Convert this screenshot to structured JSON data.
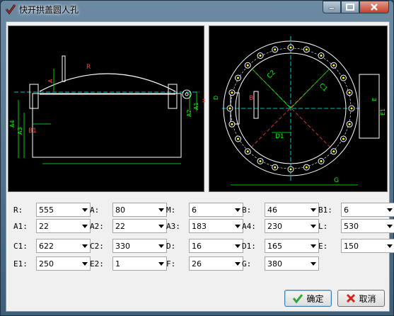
{
  "window": {
    "title": "快开拱盖圆人孔",
    "icons": {
      "app": "check-mark-icon",
      "minimize": "minimize-icon",
      "maximize": "maximize-icon",
      "close": "close-icon"
    },
    "colors": {
      "canvas_bg": "#000000",
      "drawing_white": "#ffffff",
      "dimension_green": "#00ff00",
      "centerline_cyan": "#00ffff",
      "label_red": "#ff4040",
      "bolt_yellow": "#ffff00"
    }
  },
  "drawings": {
    "side_view": {
      "labels": [
        "R",
        "A4",
        "A3",
        "A",
        "B1",
        "A2",
        "A1",
        "H"
      ]
    },
    "top_view": {
      "labels": [
        "C2",
        "C1",
        "D1",
        "D",
        "B",
        "G",
        "E1",
        "E"
      ]
    }
  },
  "params": {
    "R": {
      "label": "R:",
      "value": "555"
    },
    "A": {
      "label": "A:",
      "value": "80"
    },
    "M": {
      "label": "M:",
      "value": "6"
    },
    "B": {
      "label": "B:",
      "value": "46"
    },
    "B1": {
      "label": "B1:",
      "value": "6"
    },
    "A1": {
      "label": "A1:",
      "value": "22"
    },
    "A2": {
      "label": "A2:",
      "value": "22"
    },
    "A3": {
      "label": "A3:",
      "value": "183"
    },
    "A4": {
      "label": "A4:",
      "value": "230"
    },
    "L": {
      "label": "L:",
      "value": "530"
    },
    "C1": {
      "label": "C1:",
      "value": "622"
    },
    "C2": {
      "label": "C2:",
      "value": "330"
    },
    "D": {
      "label": "D:",
      "value": "16"
    },
    "D1": {
      "label": "D1:",
      "value": "165"
    },
    "E": {
      "label": "E:",
      "value": "150"
    },
    "E1": {
      "label": "E1:",
      "value": "250"
    },
    "E2": {
      "label": "E2:",
      "value": "1"
    },
    "F": {
      "label": "F:",
      "value": "26"
    },
    "G": {
      "label": "G:",
      "value": "380"
    }
  },
  "buttons": {
    "ok": {
      "label": "确定",
      "icon": "green-check-icon"
    },
    "cancel": {
      "label": "取消",
      "icon": "red-x-icon"
    }
  }
}
